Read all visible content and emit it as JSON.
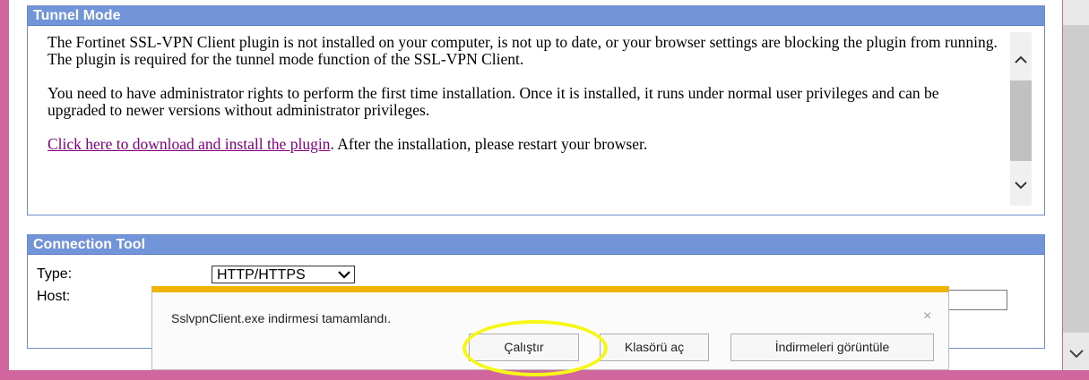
{
  "tunnel": {
    "header": "Tunnel Mode",
    "para1": "The Fortinet SSL-VPN Client plugin is not installed on your computer, is not up to date, or your browser settings are blocking the plugin from running. The plugin is required for the tunnel mode function of the SSL-VPN Client.",
    "para2": "You need to have administrator rights to perform the first time installation. Once it is installed, it runs under normal user privileges and can be upgraded to newer versions without administrator privileges.",
    "link": "Click here to download and install the plugin",
    "after_link": ". After the installation, please restart your browser."
  },
  "connection": {
    "header": "Connection Tool",
    "type_label": "Type:",
    "type_value": "HTTP/HTTPS",
    "host_label": "Host:"
  },
  "download_bar": {
    "message": "SslvpnClient.exe indirmesi tamamlandı.",
    "run_button": "Çalıştır",
    "open_folder_button": "Klasörü aç",
    "view_downloads_button": "İndirmeleri görüntüle",
    "close_icon": "×",
    "accent_color": "#f0b400"
  },
  "colors": {
    "page_border": "#d1669f",
    "panel_header": "#7195d8",
    "link": "#800080",
    "highlight": "#f7f715"
  }
}
